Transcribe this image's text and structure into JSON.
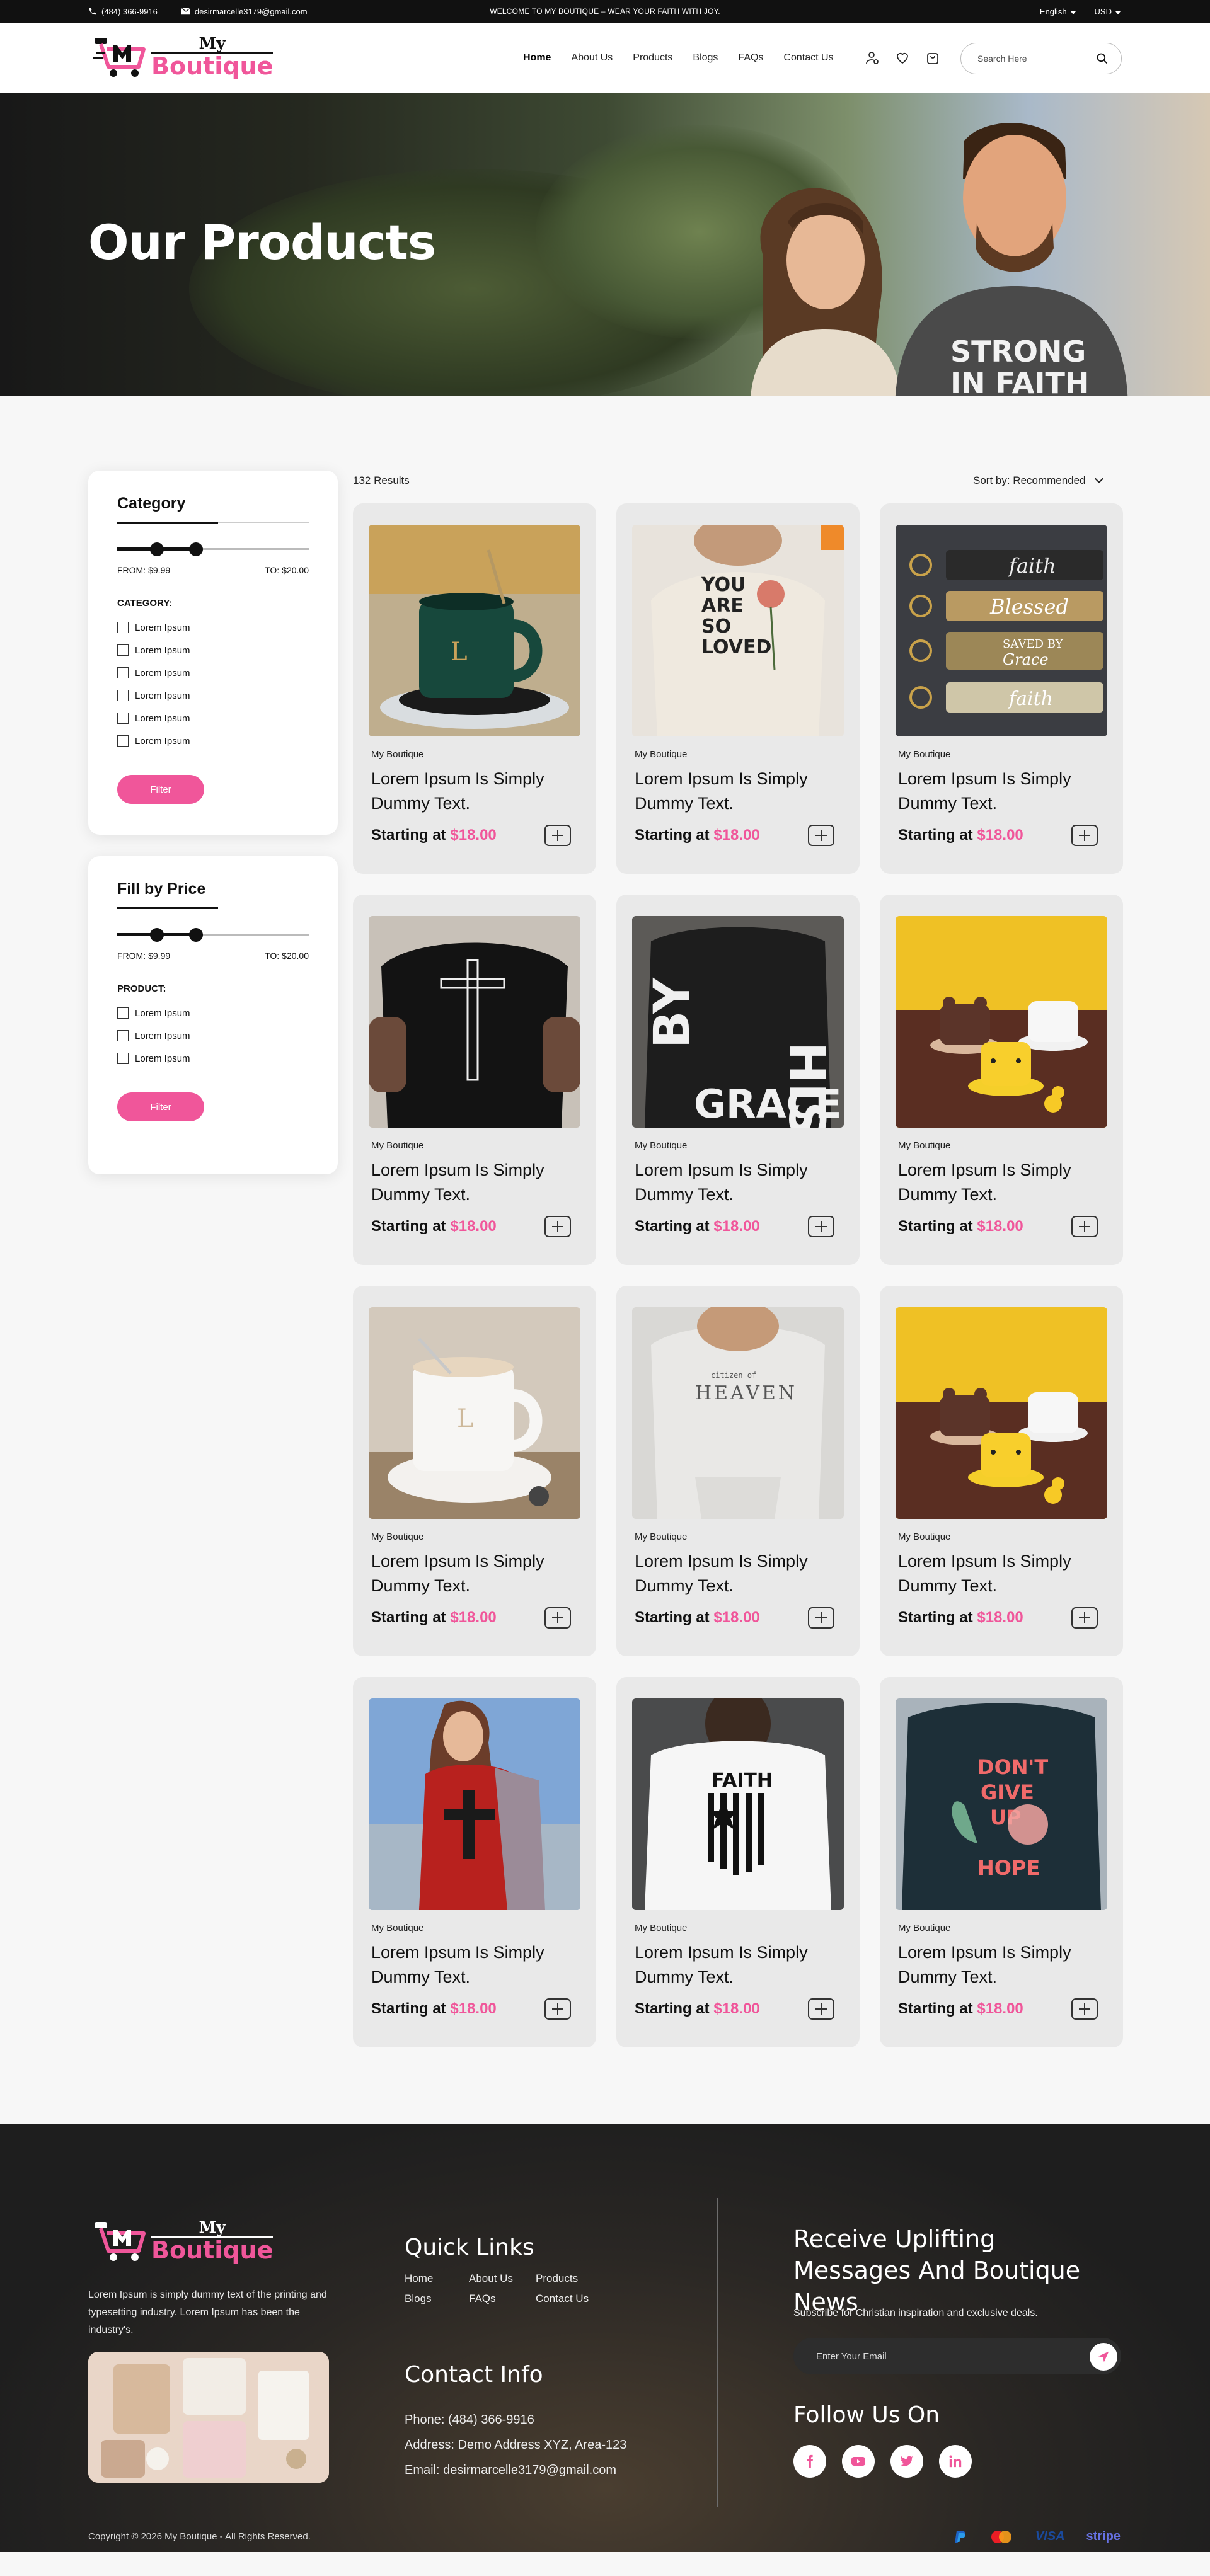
{
  "topbar": {
    "phone": "(484) 366-9916",
    "email": "desirmarcelle3179@gmail.com",
    "announcement": "WELCOME TO MY BOUTIQUE – WEAR YOUR FAITH WITH JOY.",
    "language": "English",
    "currency": "USD"
  },
  "logo": {
    "line1": "My",
    "line2": "Boutique"
  },
  "nav": [
    "Home",
    "About Us",
    "Products",
    "Blogs",
    "FAQs",
    "Contact Us"
  ],
  "search": {
    "placeholder": "Search Here"
  },
  "hero": {
    "title": "Our Products",
    "shirt_line1": "STRONG",
    "shirt_line2": "IN FAITH"
  },
  "filters": {
    "category": {
      "title": "Category",
      "from_label": "FROM:",
      "from_value": "$9.99",
      "to_label": "TO:",
      "to_value": "$20.00",
      "list_heading": "CATEGORY:",
      "options": [
        "Lorem Ipsum",
        "Lorem Ipsum",
        "Lorem Ipsum",
        "Lorem Ipsum",
        "Lorem Ipsum",
        "Lorem Ipsum"
      ],
      "button": "Filter"
    },
    "price": {
      "title": "Fill by Price",
      "from_label": "FROM:",
      "from_value": "$9.99",
      "to_label": "TO:",
      "to_value": "$20.00",
      "list_heading": "PRODUCT:",
      "options": [
        "Lorem Ipsum",
        "Lorem Ipsum",
        "Lorem Ipsum"
      ],
      "button": "Filter"
    }
  },
  "listing": {
    "results": "132 Results",
    "sort": "Sort by: Recommended"
  },
  "products": [
    {
      "brand": "My Boutique",
      "name": "Lorem Ipsum Is Simply Dummy Text.",
      "price_label": "Starting at",
      "price": "$18.00",
      "image": "green-mug-on-warmer"
    },
    {
      "brand": "My Boutique",
      "name": "Lorem Ipsum Is Simply Dummy Text.",
      "price_label": "Starting at",
      "price": "$18.00",
      "image": "you-are-so-loved-tee"
    },
    {
      "brand": "My Boutique",
      "name": "Lorem Ipsum Is Simply Dummy Text.",
      "price_label": "Starting at",
      "price": "$18.00",
      "image": "faith-keychains"
    },
    {
      "brand": "My Boutique",
      "name": "Lorem Ipsum Is Simply Dummy Text.",
      "price_label": "Starting at",
      "price": "$18.00",
      "image": "black-cross-tee"
    },
    {
      "brand": "My Boutique",
      "name": "Lorem Ipsum Is Simply Dummy Text.",
      "price_label": "Starting at",
      "price": "$18.00",
      "image": "by-his-grace-tee"
    },
    {
      "brand": "My Boutique",
      "name": "Lorem Ipsum Is Simply Dummy Text.",
      "price_label": "Starting at",
      "price": "$18.00",
      "image": "bear-mugs"
    },
    {
      "brand": "My Boutique",
      "name": "Lorem Ipsum Is Simply Dummy Text.",
      "price_label": "Starting at",
      "price": "$18.00",
      "image": "white-mug-on-warmer"
    },
    {
      "brand": "My Boutique",
      "name": "Lorem Ipsum Is Simply Dummy Text.",
      "price_label": "Starting at",
      "price": "$18.00",
      "image": "heaven-hoodie"
    },
    {
      "brand": "My Boutique",
      "name": "Lorem Ipsum Is Simply Dummy Text.",
      "price_label": "Starting at",
      "price": "$18.00",
      "image": "bear-mugs"
    },
    {
      "brand": "My Boutique",
      "name": "Lorem Ipsum Is Simply Dummy Text.",
      "price_label": "Starting at",
      "price": "$18.00",
      "image": "red-cross-tee"
    },
    {
      "brand": "My Boutique",
      "name": "Lorem Ipsum Is Simply Dummy Text.",
      "price_label": "Starting at",
      "price": "$18.00",
      "image": "faith-flag-tee"
    },
    {
      "brand": "My Boutique",
      "name": "Lorem Ipsum Is Simply Dummy Text.",
      "price_label": "Starting at",
      "price": "$18.00",
      "image": "dont-give-up-hope-tee"
    }
  ],
  "product_art": {
    "loved": [
      "YOU",
      "ARE",
      "SO",
      "LOVED"
    ],
    "keychains": [
      "faith",
      "Blessed",
      "SAVED BY",
      "Grace",
      "faith"
    ],
    "grace": [
      "BY",
      "HIS",
      "GRACE"
    ],
    "heaven_small": "citizen of",
    "heaven": "HEAVEN",
    "faith": "FAITH",
    "hope": [
      "DON'T",
      "GIVE",
      "UP",
      "HOPE"
    ],
    "mug": "L"
  },
  "footer": {
    "about": "Lorem Ipsum is simply dummy text of the printing and typesetting industry. Lorem Ipsum has been the industry's.",
    "quick_links_title": "Quick Links",
    "quick_links": [
      "Home",
      "About Us",
      "Products",
      "Blogs",
      "FAQs",
      "Contact Us"
    ],
    "contact_title": "Contact Info",
    "phone": "Phone: (484) 366-9916",
    "address": "Address: Demo Address XYZ, Area-123",
    "email": "Email: desirmarcelle3179@gmail.com",
    "subscribe_title": "Receive Uplifting Messages And Boutique News",
    "subscribe_text": "Subscribe for Christian inspiration and exclusive deals.",
    "email_placeholder": "Enter Your Email",
    "follow_title": "Follow Us On",
    "socials": [
      "facebook-icon",
      "youtube-icon",
      "twitter-icon",
      "linkedin-icon"
    ],
    "copyright": "Copyright © 2026 My Boutique - All Rights Reserved.",
    "payments": [
      "PayPal",
      "Mastercard",
      "VISA",
      "stripe"
    ]
  },
  "colors": {
    "accent": "#f0569a",
    "dark": "#111111",
    "card": "#e9e9e9"
  }
}
